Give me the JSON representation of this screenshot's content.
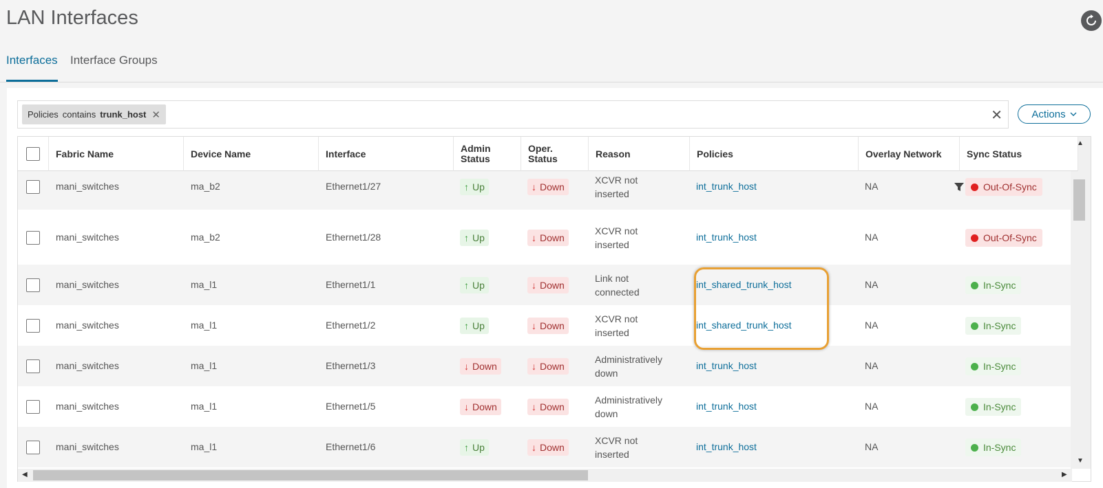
{
  "page": {
    "title": "LAN Interfaces"
  },
  "tabs": [
    {
      "label": "Interfaces",
      "active": true
    },
    {
      "label": "Interface Groups",
      "active": false
    }
  ],
  "filter": {
    "field": "Policies",
    "operator": "contains",
    "value": "trunk_host"
  },
  "actions_label": "Actions",
  "columns": {
    "fabric": "Fabric Name",
    "device": "Device Name",
    "interface": "Interface",
    "admin_line1": "Admin",
    "admin_line2": "Status",
    "oper_line1": "Oper.",
    "oper_line2": "Status",
    "reason": "Reason",
    "policies": "Policies",
    "overlay": "Overlay Network",
    "sync": "Sync Status"
  },
  "rows": [
    {
      "fabric": "mani_switches",
      "device": "ma_b2",
      "interface": "Ethernet1/27",
      "admin": "Up",
      "oper": "Down",
      "reason1": "XCVR not",
      "reason2": "inserted",
      "policy": "int_trunk_host",
      "overlay": "NA",
      "sync": "Out-Of-Sync"
    },
    {
      "fabric": "mani_switches",
      "device": "ma_b2",
      "interface": "Ethernet1/28",
      "admin": "Up",
      "oper": "Down",
      "reason1": "XCVR not",
      "reason2": "inserted",
      "policy": "int_trunk_host",
      "overlay": "NA",
      "sync": "Out-Of-Sync"
    },
    {
      "fabric": "mani_switches",
      "device": "ma_l1",
      "interface": "Ethernet1/1",
      "admin": "Up",
      "oper": "Down",
      "reason1": "Link not",
      "reason2": "connected",
      "policy": "int_shared_trunk_host",
      "overlay": "NA",
      "sync": "In-Sync"
    },
    {
      "fabric": "mani_switches",
      "device": "ma_l1",
      "interface": "Ethernet1/2",
      "admin": "Up",
      "oper": "Down",
      "reason1": "XCVR not",
      "reason2": "inserted",
      "policy": "int_shared_trunk_host",
      "overlay": "NA",
      "sync": "In-Sync"
    },
    {
      "fabric": "mani_switches",
      "device": "ma_l1",
      "interface": "Ethernet1/3",
      "admin": "Down",
      "oper": "Down",
      "reason1": "Administratively",
      "reason2": "down",
      "policy": "int_trunk_host",
      "overlay": "NA",
      "sync": "In-Sync"
    },
    {
      "fabric": "mani_switches",
      "device": "ma_l1",
      "interface": "Ethernet1/5",
      "admin": "Down",
      "oper": "Down",
      "reason1": "Administratively",
      "reason2": "down",
      "policy": "int_trunk_host",
      "overlay": "NA",
      "sync": "In-Sync"
    },
    {
      "fabric": "mani_switches",
      "device": "ma_l1",
      "interface": "Ethernet1/6",
      "admin": "Up",
      "oper": "Down",
      "reason1": "XCVR not",
      "reason2": "inserted",
      "policy": "int_trunk_host",
      "overlay": "NA",
      "sync": "In-Sync"
    }
  ],
  "icons": {
    "refresh": "refresh-icon",
    "filter": "funnel-icon",
    "up": "arrow-up-icon",
    "down": "arrow-down-icon",
    "actions_caret": "chevron-down-icon"
  },
  "colors": {
    "accent": "#0d6e9a",
    "highlight": "#e8a033",
    "out_of_sync": "#e02020",
    "in_sync": "#4cb04c"
  }
}
